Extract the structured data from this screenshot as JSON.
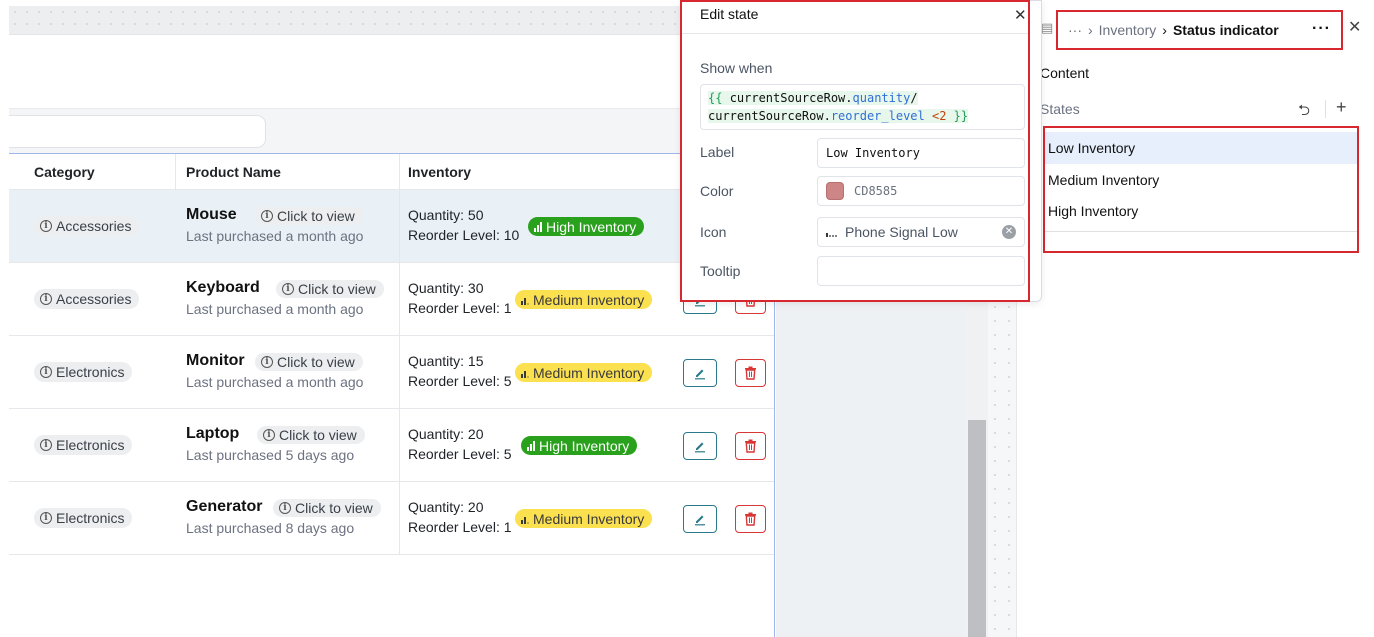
{
  "table": {
    "headers": {
      "category": "Category",
      "product": "Product Name",
      "inventory": "Inventory"
    },
    "rows": [
      {
        "category": "Accessories",
        "product": "Mouse",
        "view": "Click to view",
        "last": "Last purchased a month ago",
        "quantity": "Quantity: 50",
        "reorder": "Reorder Level: 10",
        "status": "High Inventory",
        "level": "high"
      },
      {
        "category": "Accessories",
        "product": "Keyboard",
        "view": "Click to view",
        "last": "Last purchased a month ago",
        "quantity": "Quantity: 30",
        "reorder": "Reorder Level: 1",
        "status": "Medium Inventory",
        "level": "medium"
      },
      {
        "category": "Electronics",
        "product": "Monitor",
        "view": "Click to view",
        "last": "Last purchased a month ago",
        "quantity": "Quantity: 15",
        "reorder": "Reorder Level: 5",
        "status": "Medium Inventory",
        "level": "medium"
      },
      {
        "category": "Electronics",
        "product": "Laptop",
        "view": "Click to view",
        "last": "Last purchased 5 days ago",
        "quantity": "Quantity: 20",
        "reorder": "Reorder Level: 5",
        "status": "High Inventory",
        "level": "high"
      },
      {
        "category": "Electronics",
        "product": "Generator",
        "view": "Click to view",
        "last": "Last purchased 8 days ago",
        "quantity": "Quantity: 20",
        "reorder": "Reorder Level: 1",
        "status": "Medium Inventory",
        "level": "medium"
      }
    ]
  },
  "popup": {
    "title": "Edit state",
    "show_when_label": "Show when",
    "code_line1_open": "{{",
    "code_line1_obj": "currentSourceRow.",
    "code_line1_prop": "quantity",
    "code_line1_op": "/",
    "code_line2_obj": "currentSourceRow.",
    "code_line2_prop": "reorder_level",
    "code_line2_cmp": "<2",
    "code_line2_close": "}}",
    "label_label": "Label",
    "label_value": "Low Inventory",
    "color_label": "Color",
    "color_value": "CD8585",
    "icon_label": "Icon",
    "icon_value": "Phone Signal Low",
    "tooltip_label": "Tooltip",
    "tooltip_value": ""
  },
  "inspector": {
    "breadcrumb_more": "···",
    "breadcrumb_parent": "Inventory",
    "breadcrumb_current": "Status indicator",
    "content_label": "Content",
    "states_label": "States",
    "states": [
      "Low Inventory",
      "Medium Inventory",
      "High Inventory"
    ]
  },
  "colors": {
    "swatch": "#CD8585",
    "high": "#2aa11d",
    "medium": "#fbe04f",
    "highlight": "#d7282f"
  }
}
